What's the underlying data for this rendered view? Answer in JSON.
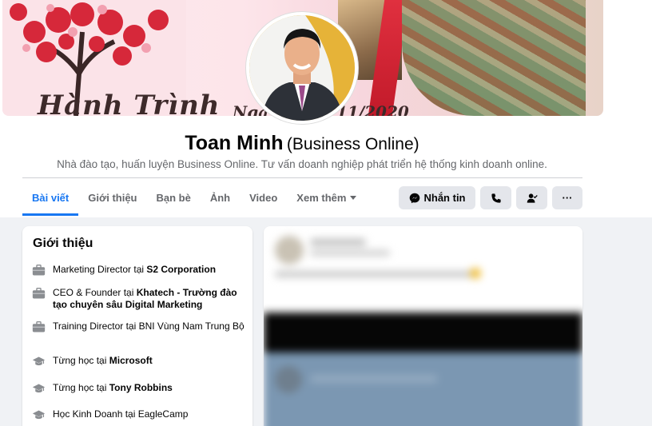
{
  "cover": {
    "headline": "Hành Trình",
    "date_prefix": "Ngày",
    "date_suffix": "11/2020"
  },
  "profile": {
    "name": "Toan Minh",
    "name_suffix": "(Business Online)",
    "bio": "Nhà đào tạo, huấn luyện Business Online. Tư vấn doanh nghiệp phát triển hệ thống kinh doanh online."
  },
  "tabs": [
    {
      "label": "Bài viết",
      "active": true
    },
    {
      "label": "Giới thiệu"
    },
    {
      "label": "Bạn bè"
    },
    {
      "label": "Ảnh"
    },
    {
      "label": "Video"
    },
    {
      "label": "Xem thêm"
    }
  ],
  "actions": {
    "message_label": "Nhắn tin",
    "more_label": "···"
  },
  "intro": {
    "title": "Giới thiệu",
    "items": [
      {
        "icon": "briefcase-icon",
        "prefix": "Marketing Director tại ",
        "bold": "S2 Corporation"
      },
      {
        "icon": "briefcase-icon",
        "prefix": "CEO & Founder tại ",
        "bold": "Khatech - Trường đào tạo chuyên sâu Digital Marketing"
      },
      {
        "icon": "briefcase-icon",
        "prefix": "Training Director tại BNI Vùng Nam Trung Bộ",
        "bold": ""
      },
      {
        "icon": "graduation-cap-icon",
        "prefix": "Từng học tại ",
        "bold": "Microsoft"
      },
      {
        "icon": "graduation-cap-icon",
        "prefix": "Từng học tại ",
        "bold": "Tony Robbins"
      },
      {
        "icon": "graduation-cap-icon",
        "prefix": "Học Kinh Doanh tại EagleCamp",
        "bold": ""
      }
    ]
  },
  "colors": {
    "accent": "#1877f2",
    "secondary_text": "#65676b",
    "button_bg": "#e4e6eb",
    "page_bg": "#f0f2f5"
  }
}
